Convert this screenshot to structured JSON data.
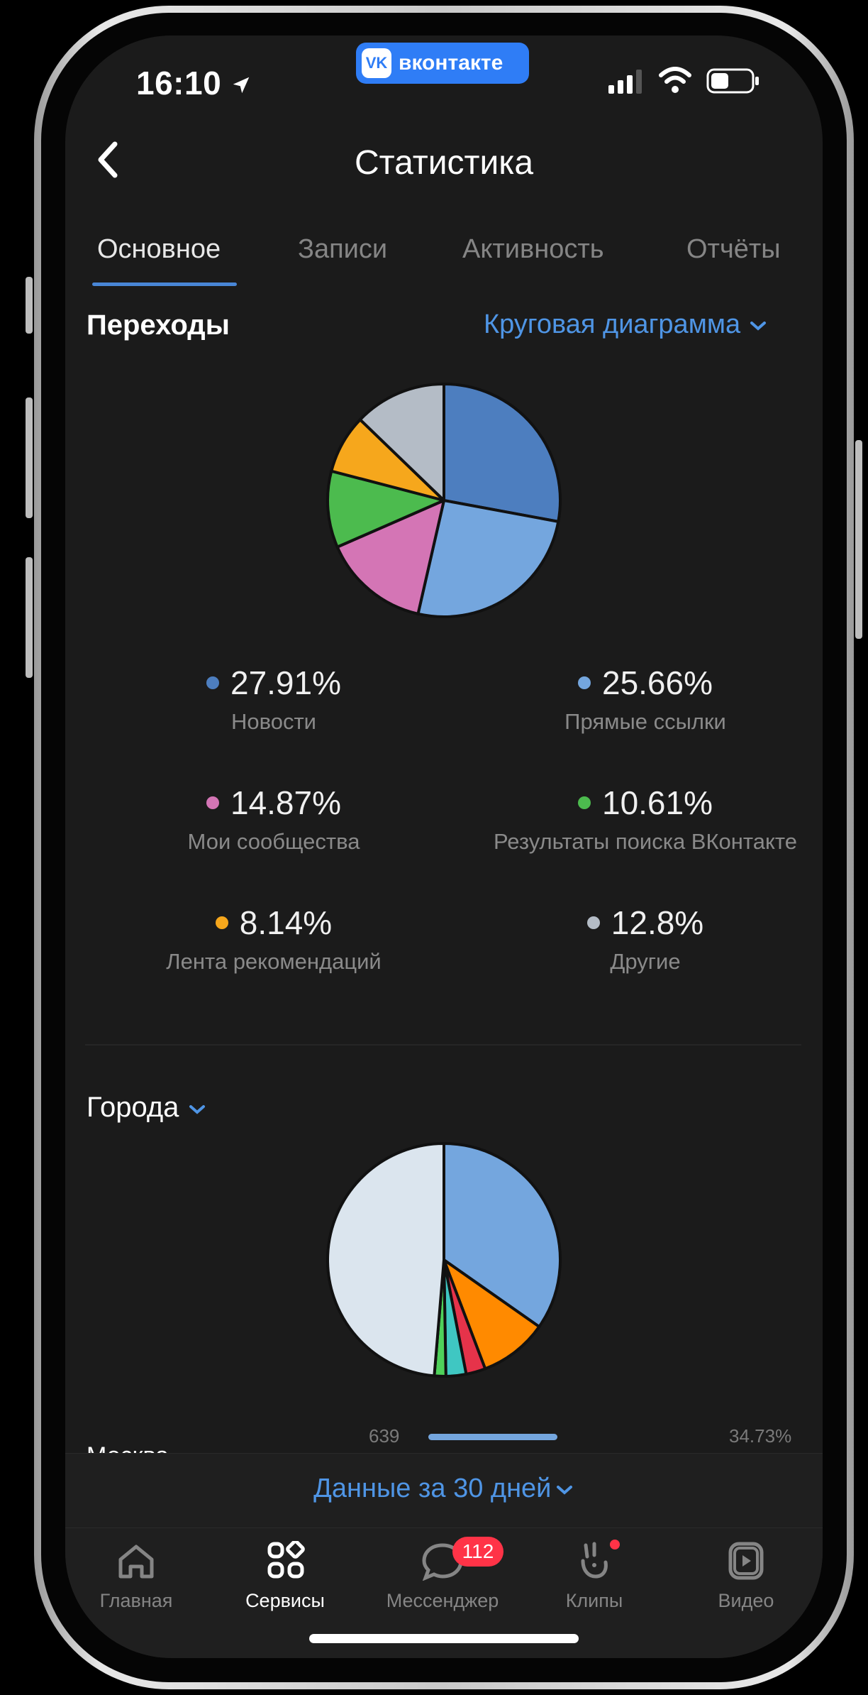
{
  "status": {
    "time": "16:10",
    "app_pill": "вконтакте",
    "vk_logo": "VK"
  },
  "header": {
    "title": "Статистика",
    "back_icon": "chevron-left-icon"
  },
  "tabs": [
    {
      "label": "Основное",
      "active": true
    },
    {
      "label": "Записи",
      "active": false
    },
    {
      "label": "Активность",
      "active": false
    },
    {
      "label": "Отчёты",
      "active": false
    }
  ],
  "transitions": {
    "title": "Переходы",
    "chart_type_label": "Круговая диаграмма",
    "legend": [
      {
        "value": "27.91%",
        "label": "Новости",
        "color": "#4d7ebf"
      },
      {
        "value": "25.66%",
        "label": "Прямые ссылки",
        "color": "#74a6de"
      },
      {
        "value": "14.87%",
        "label": "Мои сообщества",
        "color": "#d475b5"
      },
      {
        "value": "10.61%",
        "label": "Результаты поиска ВКонтакте",
        "color": "#4cbb4e"
      },
      {
        "value": "8.14%",
        "label": "Лента рекомендаций",
        "color": "#f6a71c"
      },
      {
        "value": "12.8%",
        "label": "Другие",
        "color": "#b4bcc6"
      }
    ]
  },
  "cities": {
    "title": "Города",
    "rows": [
      {
        "name": "Москва",
        "count": "639",
        "percent": "34.73%",
        "fraction": 0.3473
      }
    ]
  },
  "footer": {
    "period_label": "Данные за 30 дней"
  },
  "nav": {
    "items": [
      {
        "label": "Главная",
        "icon": "home-icon",
        "active": false
      },
      {
        "label": "Сервисы",
        "icon": "services-icon",
        "active": true
      },
      {
        "label": "Мессенджер",
        "icon": "messenger-icon",
        "active": false,
        "badge": "112"
      },
      {
        "label": "Клипы",
        "icon": "clips-icon",
        "active": false
      },
      {
        "label": "Видео",
        "icon": "video-icon",
        "active": false
      }
    ]
  },
  "chart_data": [
    {
      "type": "pie",
      "title": "Переходы",
      "categories": [
        "Новости",
        "Прямые ссылки",
        "Мои сообщества",
        "Результаты поиска ВКонтакте",
        "Лента рекомендаций",
        "Другие"
      ],
      "values": [
        27.91,
        25.66,
        14.87,
        10.61,
        8.14,
        12.8
      ],
      "colors": [
        "#4d7ebf",
        "#74a6de",
        "#d475b5",
        "#4cbb4e",
        "#f6a71c",
        "#b4bcc6"
      ]
    },
    {
      "type": "pie",
      "title": "Города",
      "categories": [
        "Москва"
      ],
      "values": [
        34.73,
        9.5,
        2.7,
        2.8,
        1.6,
        48.67
      ],
      "colors": [
        "#74a6de",
        "#ff8a00",
        "#e6334a",
        "#3fc7c2",
        "#4fd15a",
        "#dbe5ee"
      ]
    }
  ]
}
